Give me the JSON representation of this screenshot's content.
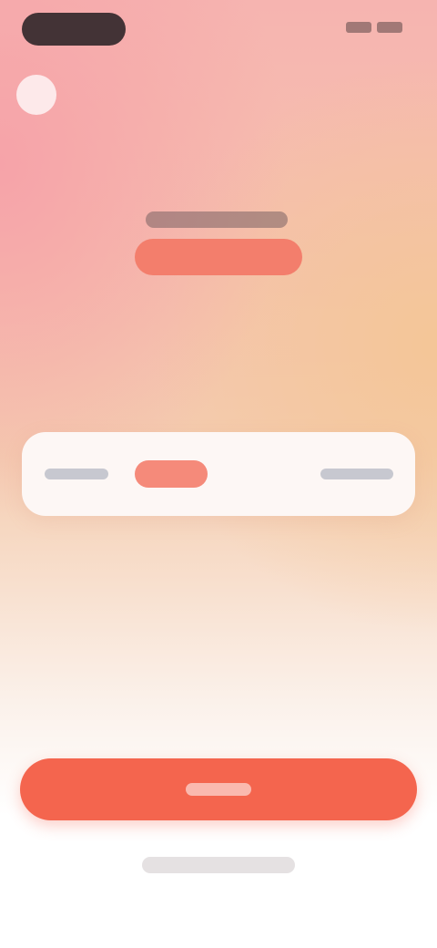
{
  "status_bar": {
    "time": "",
    "indicators": [
      "signal-icon",
      "wifi-icon",
      "battery-icon"
    ]
  },
  "nav": {
    "back_icon": "back-icon"
  },
  "header": {
    "title": "",
    "highlight": ""
  },
  "selector": {
    "options": [
      "",
      "",
      "",
      ""
    ],
    "selected_index": 1
  },
  "cta": {
    "label": ""
  },
  "secondary": {
    "label": ""
  },
  "colors": {
    "accent": "#f4654e",
    "highlight": "#f37e6c",
    "selected_segment": "#f58a7a"
  }
}
